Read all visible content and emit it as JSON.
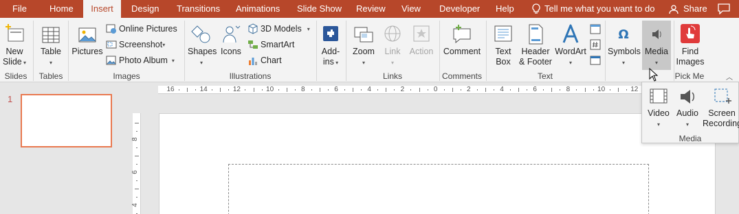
{
  "tabs": {
    "file": "File",
    "home": "Home",
    "insert": "Insert",
    "design": "Design",
    "transitions": "Transitions",
    "animations": "Animations",
    "slideshow": "Slide Show",
    "review": "Review",
    "view": "View",
    "developer": "Developer",
    "help": "Help",
    "tell_me": "Tell me what you want to do",
    "share": "Share"
  },
  "ribbon": {
    "slides": {
      "new_slide_1": "New",
      "new_slide_2": "Slide",
      "label": "Slides"
    },
    "tables": {
      "table": "Table",
      "label": "Tables"
    },
    "images": {
      "pictures": "Pictures",
      "online_pictures": "Online Pictures",
      "screenshot": "Screenshot",
      "photo_album": "Photo Album",
      "label": "Images"
    },
    "illustrations": {
      "shapes": "Shapes",
      "icons": "Icons",
      "models_3d": "3D Models",
      "smartart": "SmartArt",
      "chart": "Chart",
      "label": "Illustrations"
    },
    "addins": {
      "addins_1": "Add-",
      "addins_2": "ins"
    },
    "links": {
      "zoom": "Zoom",
      "link": "Link",
      "action": "Action",
      "label": "Links"
    },
    "comments": {
      "comment": "Comment",
      "label": "Comments"
    },
    "text": {
      "textbox_1": "Text",
      "textbox_2": "Box",
      "header_1": "Header",
      "header_2": "& Footer",
      "wordart": "WordArt",
      "label": "Text"
    },
    "symbols": {
      "symbols": "Symbols"
    },
    "media": {
      "media": "Media"
    },
    "pickme": {
      "find_1": "Find",
      "find_2": "Images",
      "label": "Pick Me"
    }
  },
  "thumbs": {
    "slide_number": "1"
  },
  "ruler": {
    "h_ticks": [
      "16",
      "14",
      "12",
      "10",
      "8",
      "6",
      "4",
      "2",
      "0",
      "2",
      "4",
      "6",
      "8",
      "10",
      "12"
    ],
    "v_ticks": [
      "8",
      "6",
      "4"
    ]
  },
  "media_menu": {
    "video": "Video",
    "audio": "Audio",
    "screen_1": "Screen",
    "screen_2": "Recording",
    "label": "Media"
  },
  "colors": {
    "accent": "#b7472a",
    "ribbon_bg": "#f3f3f3",
    "thumb_border": "#e9784f",
    "workspace_bg": "#e6e6e6"
  }
}
